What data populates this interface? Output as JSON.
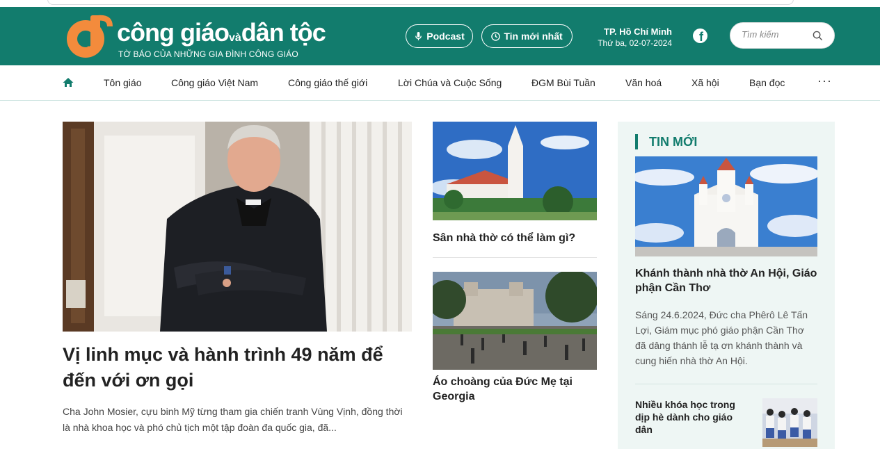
{
  "header": {
    "logo_text_1": "công giáo",
    "logo_text_va": "và",
    "logo_text_2": "dân tộc",
    "slogan": "TỜ BÁO CỦA NHỮNG GIA ĐÌNH CÔNG GIÁO",
    "podcast_label": "Podcast",
    "latest_label": "Tin mới nhất",
    "city": "TP. Hồ Chí Minh",
    "date": "Thứ ba, 02-07-2024",
    "search_placeholder": "Tìm kiếm"
  },
  "nav": {
    "items": [
      {
        "label": "Tôn giáo"
      },
      {
        "label": "Công giáo Việt Nam"
      },
      {
        "label": "Công giáo thế giới"
      },
      {
        "label": "Lời Chúa và Cuộc Sống"
      },
      {
        "label": "ĐGM Bùi Tuần"
      },
      {
        "label": "Văn hoá"
      },
      {
        "label": "Xã hội"
      },
      {
        "label": "Bạn đọc"
      }
    ],
    "more_label": "···"
  },
  "featured": {
    "title": "Vị linh mục và hành trình 49 năm để đến với ơn gọi",
    "sapo": "Cha John Mosier, cựu binh Mỹ từng tham gia chiến tranh Vùng Vịnh, đồng thời là nhà khoa học và phó chủ tịch một tập đoàn đa quốc gia, đã..."
  },
  "middle": {
    "articles": [
      {
        "title": "Sân nhà thờ có thể làm gì?"
      },
      {
        "title": "Áo choàng của Đức Mẹ tại Georgia"
      }
    ]
  },
  "sidebar": {
    "heading": "TIN MỚI",
    "lead_title": "Khánh thành nhà thờ An Hội, Giáo phận Cần Thơ",
    "lead_sapo": "Sáng 24.6.2024, Đức cha Phêrô Lê Tấn Lợi, Giám mục phó giáo phận Cần Thơ đã dâng thánh lễ tạ ơn khánh thành và cung hiến nhà thờ An Hội.",
    "item_title": "Nhiều khóa học trong dịp hè dành cho giáo dân"
  },
  "colors": {
    "brand_green": "#127c6d",
    "logo_orange": "#f38b3c",
    "sidebar_bg": "#eef6f4"
  }
}
